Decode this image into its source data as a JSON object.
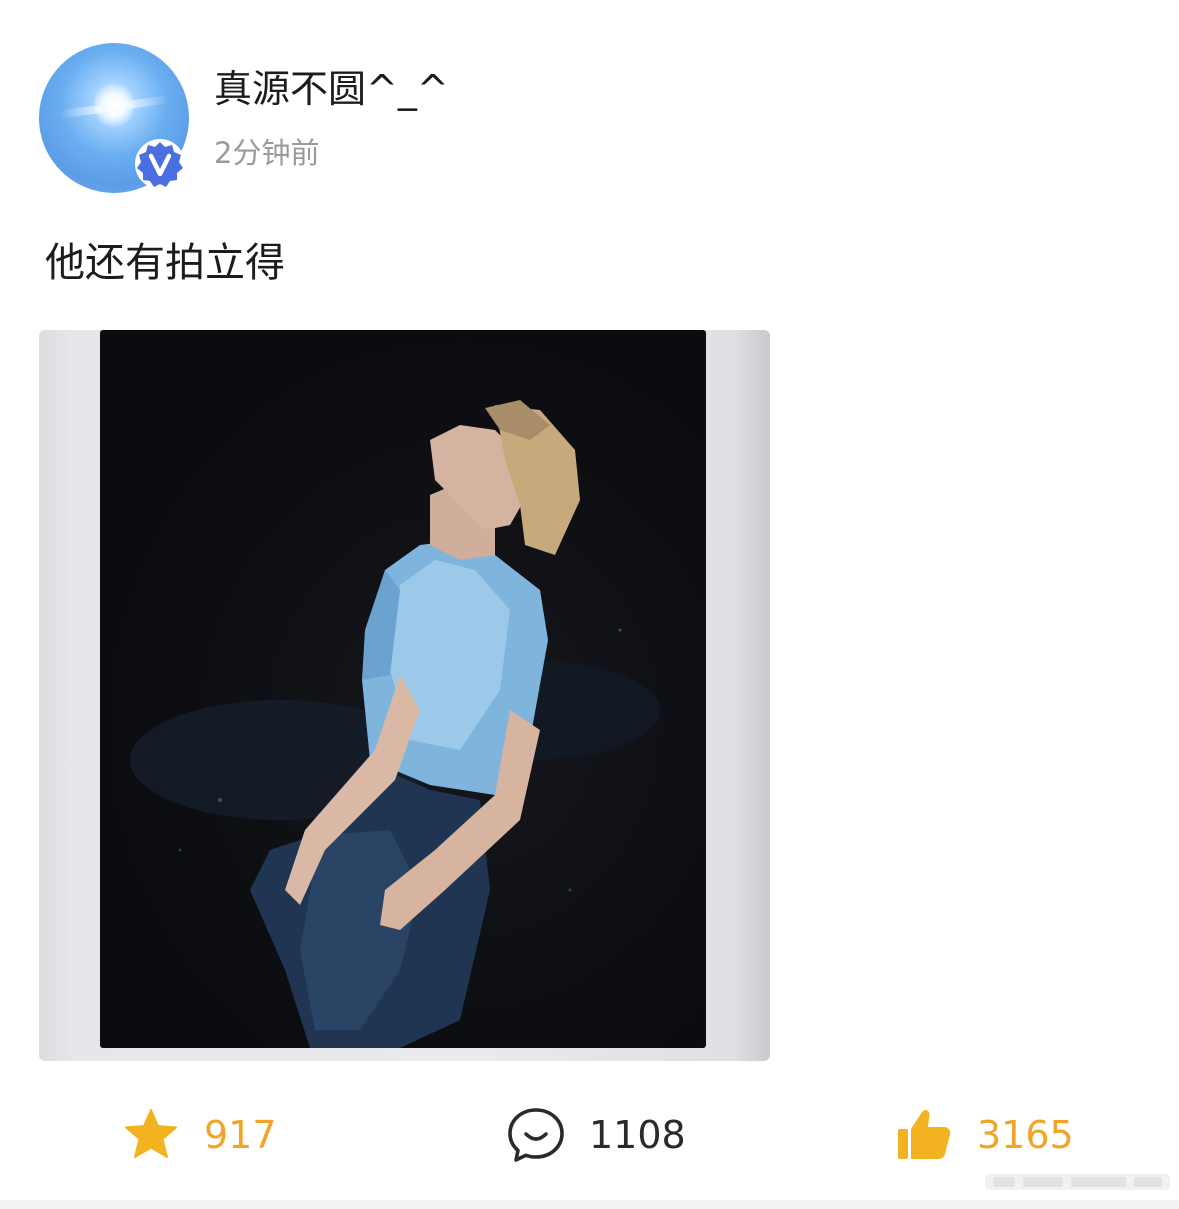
{
  "post": {
    "author": "真源不圆^_^",
    "time": "2分钟前",
    "text": "他还有拍立得"
  },
  "actions": {
    "favorites": "917",
    "comments": "1108",
    "likes": "3165"
  },
  "colors": {
    "accent": "#f0a52a",
    "verified_badge": "#4b6fe0",
    "timestamp": "#9a9a9a"
  },
  "icons": {
    "favorite": "star-icon",
    "comment": "speech-bubble-icon",
    "like": "thumbs-up-icon",
    "verified": "verified-v-badge-icon"
  }
}
